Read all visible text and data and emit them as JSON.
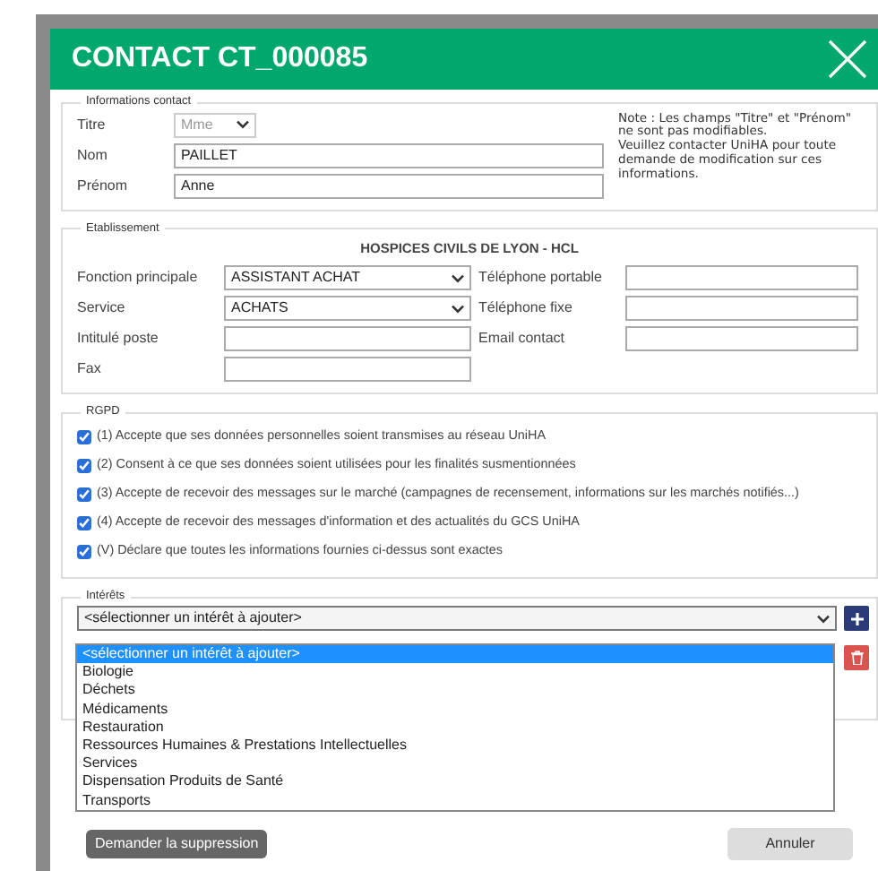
{
  "dialog": {
    "title": "CONTACT CT_000085"
  },
  "contact": {
    "legend": "Informations contact",
    "fields": [
      {
        "label": "Titre",
        "kind": "select",
        "value": "Mme",
        "disabled": true
      },
      {
        "label": "Nom",
        "kind": "text",
        "value": "PAILLET",
        "disabled": false
      },
      {
        "label": "Prénom",
        "kind": "text",
        "value": "Anne",
        "disabled": false
      }
    ],
    "note": [
      "Note : Les champs \"Titre\" et \"Prénom\" ne sont pas modifiables.",
      "Veuillez contacter UniHA pour toute demande de modification sur ces informations."
    ]
  },
  "establishment": {
    "legend": "Etablissement",
    "name": "HOSPICES CIVILS DE LYON - HCL",
    "rows": [
      [
        {
          "label": "Fonction principale",
          "kind": "select",
          "value": "ASSISTANT ACHAT"
        },
        {
          "label": "Téléphone portable",
          "kind": "text"
        }
      ],
      [
        {
          "label": "Service",
          "kind": "select",
          "value": "ACHATS"
        },
        {
          "label": "Téléphone fixe",
          "kind": "text"
        }
      ],
      [
        {
          "label": "Intitulé poste",
          "kind": "text"
        },
        {
          "label": "Email contact",
          "kind": "text"
        }
      ],
      [
        {
          "label": "Fax",
          "kind": "text"
        }
      ]
    ]
  },
  "rgpd": {
    "legend": "RGPD",
    "consents": [
      {
        "text": "(1) Accepte que ses données personnelles soient transmises au réseau UniHA",
        "checked": true
      },
      {
        "text": "(2) Consent à ce que ses données soient utilisées pour les finalités susmentionnées",
        "checked": true
      },
      {
        "text": "(3) Accepte de recevoir des messages sur le marché (campagnes de recensement, informations sur les marchés notifiés...)",
        "checked": true
      },
      {
        "text": "(4) Accepte de recevoir des messages d'information et des actualités du GCS UniHA",
        "checked": true
      },
      {
        "text": "(V) Déclare que toutes les informations fournies ci-dessus sont exactes",
        "checked": true
      }
    ]
  },
  "interests": {
    "legend": "Intérêts",
    "select": {
      "value": "<sélectionner un intérêt à ajouter>",
      "expanded": true
    },
    "options": [
      {
        "label": "<sélectionner un intérêt à ajouter>",
        "selected": true
      },
      {
        "label": "Biologie",
        "selected": false
      },
      {
        "label": "Déchets",
        "selected": false
      },
      {
        "label": "Médicaments",
        "selected": false
      },
      {
        "label": "Restauration",
        "selected": false
      },
      {
        "label": "Ressources Humaines & Prestations Intellectuelles",
        "selected": false
      },
      {
        "label": "Services",
        "selected": false
      },
      {
        "label": "Dispensation Produits de Santé",
        "selected": false
      },
      {
        "label": "Transports",
        "selected": false
      }
    ]
  },
  "buttons": [
    {
      "label": "Demander la suppression",
      "kind": "secondary"
    },
    {
      "label": "Annuler",
      "kind": "light"
    }
  ]
}
